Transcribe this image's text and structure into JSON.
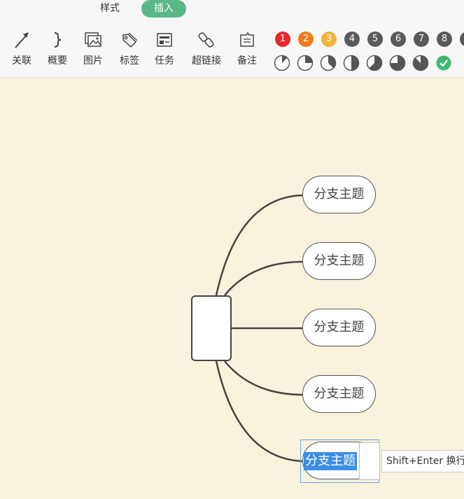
{
  "tabs": {
    "style": "样式",
    "insert": "插入"
  },
  "toolbar": {
    "tools": [
      {
        "label": "关联",
        "icon": "relation-arrow-icon"
      },
      {
        "label": "概要",
        "icon": "summary-brace-icon"
      },
      {
        "label": "图片",
        "icon": "image-icon"
      },
      {
        "label": "标签",
        "icon": "tag-icon"
      },
      {
        "label": "任务",
        "icon": "task-icon"
      },
      {
        "label": "超链接",
        "icon": "hyperlink-icon"
      },
      {
        "label": "备注",
        "icon": "note-icon"
      }
    ],
    "priorities": [
      {
        "label": "1",
        "color": "#e52727"
      },
      {
        "label": "2",
        "color": "#f07b1d"
      },
      {
        "label": "3",
        "color": "#f5b23a"
      },
      {
        "label": "4",
        "color": "#5a5a5a"
      },
      {
        "label": "5",
        "color": "#5a5a5a"
      },
      {
        "label": "6",
        "color": "#5a5a5a"
      },
      {
        "label": "7",
        "color": "#5a5a5a"
      },
      {
        "label": "8",
        "color": "#5a5a5a"
      }
    ],
    "progress_levels": [
      0.125,
      0.25,
      0.375,
      0.5,
      0.625,
      0.75,
      0.875,
      1.0
    ],
    "progress_done_color": "#3dbb6b"
  },
  "mindmap": {
    "branches": [
      "分支主题",
      "分支主题",
      "分支主题",
      "分支主题"
    ],
    "editing_branch": "分支主题",
    "hint": "Shift+Enter 换行"
  }
}
